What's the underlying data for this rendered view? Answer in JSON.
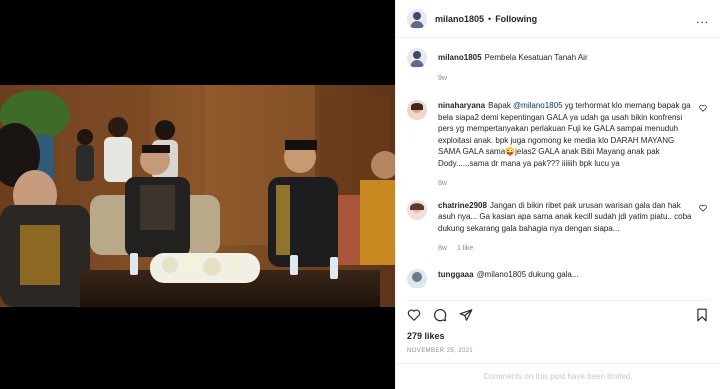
{
  "header": {
    "username": "milano1805",
    "separator": "•",
    "follow_label": "Following",
    "more_label": "..."
  },
  "caption": {
    "username": "milano1805",
    "text": "Pembela Kesatuan Tanah Air",
    "time": "9w"
  },
  "comments": [
    {
      "username": "ninaharyana",
      "text_before": "Bapak ",
      "mention": "@milano1805",
      "text_after": " yg terhormat klo memang bapak ga bela siapa2 demi kepentingan GALA ya udah ga usah bikin konfrensi pers yg mempertanyakan perlakuan Fuji ke GALA sampai menuduh exploitasi anak. bpk juga ngomong ke media klo DARAH MAYANG SAMA GALA sama😜jelas2 GALA anak Bibi Mayang anak pak Dody......sama dr mana ya pak??? iiiiiih bpk lucu ya",
      "time": "8w"
    },
    {
      "username": "chatrine2908",
      "text": "Jangan di bikin ribet pak urusan warisan gala dan hak asuh nya... Ga kasian apa sama anak kecill sudah jdi yatim piatu.. coba dukung sekarang gala bahagia nya dengan siapa...",
      "time": "8w",
      "likes": "1 like"
    },
    {
      "username": "tunggaaa",
      "text": "@milano1805 dukung gala...",
      "time": ""
    }
  ],
  "likes": "279 likes",
  "date": "NOVEMBER 25, 2021",
  "footer_note": "Comments on this post have been limited."
}
